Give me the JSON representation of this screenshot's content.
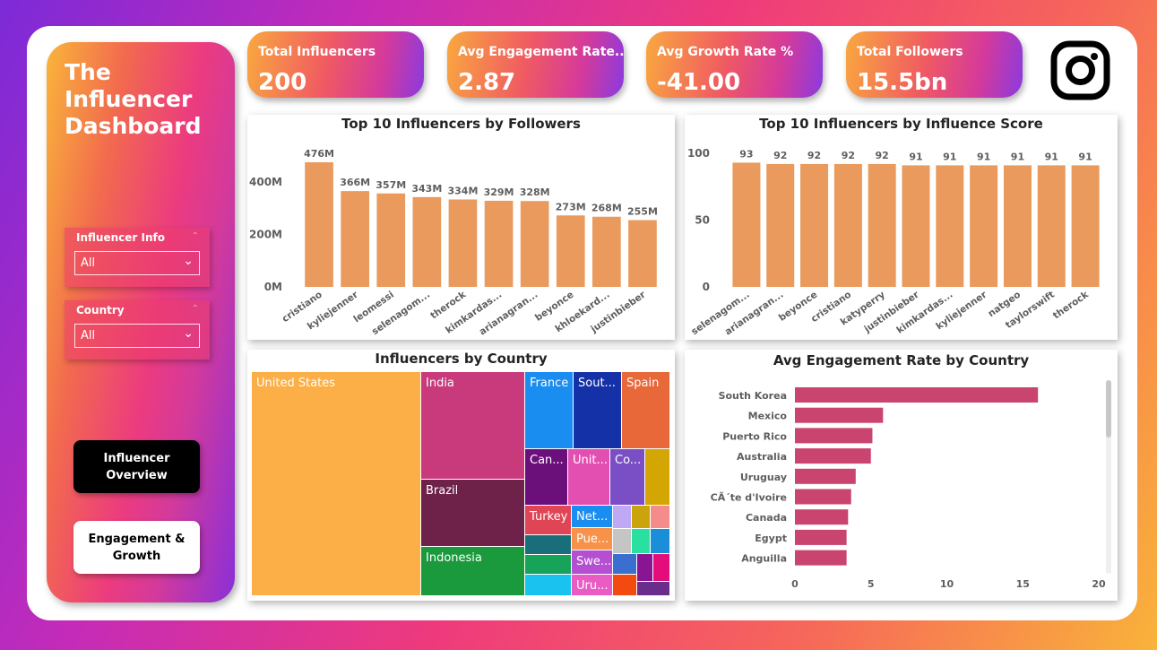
{
  "sidebar": {
    "title": "The\nInfluencer\nDashboard",
    "slicers": [
      {
        "label": "Influencer Info",
        "value": "All"
      },
      {
        "label": "Country",
        "value": "All"
      }
    ],
    "nav": [
      {
        "label": "Influencer Overview",
        "active": true
      },
      {
        "label": "Engagement &\nGrowth",
        "active": false
      }
    ]
  },
  "kpis": [
    {
      "label": "Total Influencers",
      "value": "200"
    },
    {
      "label": "Avg Engagement Rate...",
      "value": "2.87"
    },
    {
      "label": "Avg Growth Rate %",
      "value": "-41.00"
    },
    {
      "label": "Total Followers",
      "value": "15.5bn"
    }
  ],
  "logo": "instagram-icon",
  "colors": {
    "bar": "#e99a5c",
    "hbar": "#c9446f",
    "text": "#252423"
  },
  "chart_data": [
    {
      "type": "bar",
      "title": "Top 10 Influencers by Followers",
      "categories": [
        "cristiano",
        "kyliejenner",
        "leomessi",
        "selenagom...",
        "therock",
        "kimkardas...",
        "arianagran...",
        "beyonce",
        "khloekard...",
        "justinbieber"
      ],
      "values": [
        476,
        366,
        357,
        343,
        334,
        329,
        328,
        273,
        268,
        255
      ],
      "data_labels": [
        "476M",
        "366M",
        "357M",
        "343M",
        "334M",
        "329M",
        "328M",
        "273M",
        "268M",
        "255M"
      ],
      "ylim": [
        0,
        476
      ],
      "yticks": [
        0,
        200,
        400
      ],
      "ytick_labels": [
        "0M",
        "200M",
        "400M"
      ]
    },
    {
      "type": "bar",
      "title": "Top 10 Influencers by Influence Score",
      "categories": [
        "selenagom...",
        "arianagran...",
        "beyonce",
        "cristiano",
        "katyperry",
        "justinbieber",
        "kimkardas...",
        "kyliejenner",
        "natgeo",
        "taylorswift",
        "therock"
      ],
      "values": [
        93,
        92,
        92,
        92,
        92,
        91,
        91,
        91,
        91,
        91,
        91
      ],
      "data_labels": [
        "93",
        "92",
        "92",
        "92",
        "92",
        "91",
        "91",
        "91",
        "91",
        "91",
        "91"
      ],
      "ylim": [
        0,
        100
      ],
      "yticks": [
        0,
        50,
        100
      ],
      "ytick_labels": [
        "0",
        "50",
        "100"
      ]
    },
    {
      "type": "treemap",
      "title": "Influencers by Country",
      "labels": [
        "United States",
        "India",
        "Brazil",
        "Indonesia",
        "France",
        "Sout...",
        "Spain",
        "Can...",
        "Unit...",
        "Co...",
        "Turkey",
        "Net...",
        "Pue...",
        "Swe...",
        "Uru..."
      ]
    },
    {
      "type": "bar",
      "orientation": "horizontal",
      "title": "Avg Engagement Rate by Country",
      "categories": [
        "South Korea",
        "Mexico",
        "Puerto Rico",
        "Australia",
        "Uruguay",
        "CÃ´te d'Ivoire",
        "Canada",
        "Egypt",
        "Anguilla"
      ],
      "values": [
        16.0,
        5.8,
        5.1,
        5.0,
        4.0,
        3.7,
        3.5,
        3.4,
        3.4
      ],
      "xlim": [
        0,
        20
      ],
      "xticks": [
        0,
        5,
        10,
        15,
        20
      ]
    }
  ]
}
